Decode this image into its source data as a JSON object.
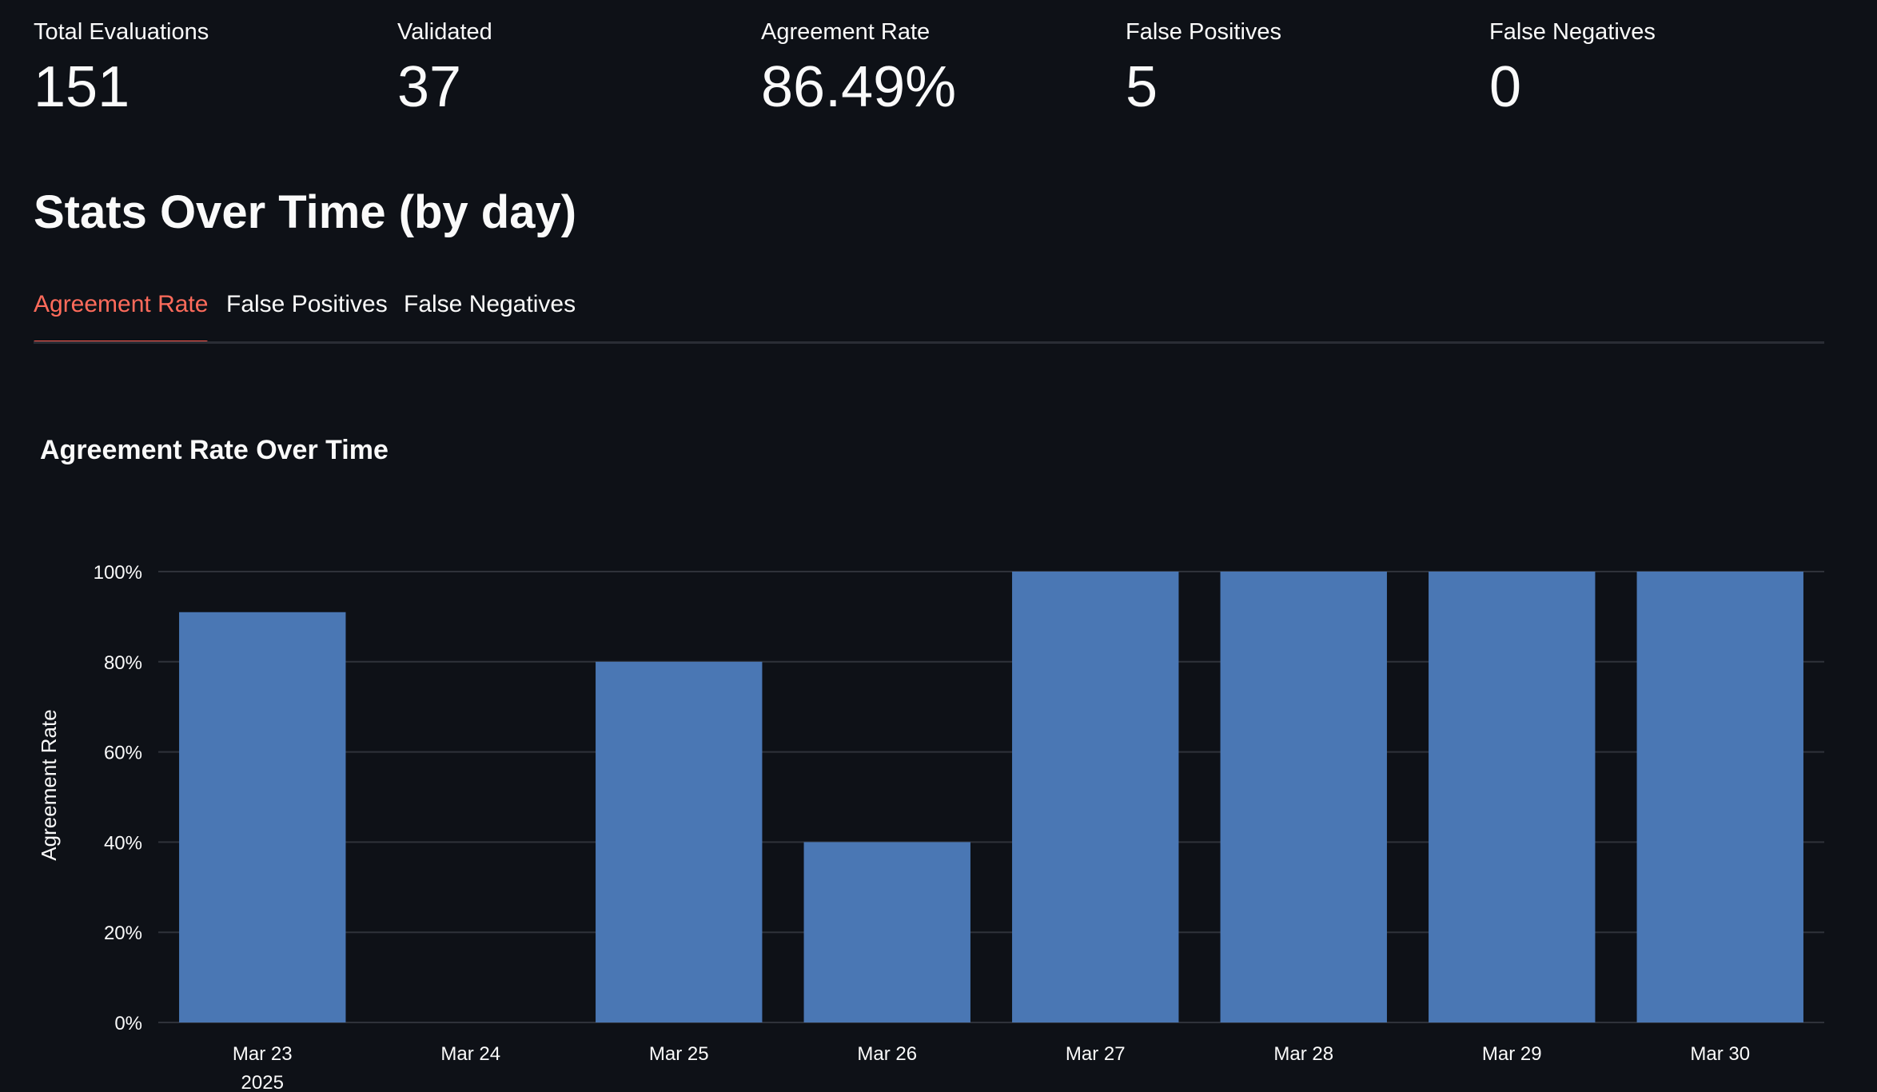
{
  "metrics": [
    {
      "label": "Total Evaluations",
      "value": "151"
    },
    {
      "label": "Validated",
      "value": "37"
    },
    {
      "label": "Agreement Rate",
      "value": "86.49%"
    },
    {
      "label": "False Positives",
      "value": "5"
    },
    {
      "label": "False Negatives",
      "value": "0"
    }
  ],
  "section": {
    "title": "Stats Over Time (by day)"
  },
  "tabs": [
    {
      "label": "Agreement Rate",
      "active": true
    },
    {
      "label": "False Positives",
      "active": false
    },
    {
      "label": "False Negatives",
      "active": false
    }
  ],
  "colors": {
    "background": "#0e1117",
    "accent": "#ff5a4f",
    "bar": "#4a77b4",
    "grid": "#2f323a",
    "text": "#fafafa"
  },
  "chart_data": {
    "type": "bar",
    "title": "Agreement Rate Over Time",
    "ylabel": "Agreement Rate",
    "xlabel": "",
    "year_label": "2025",
    "categories": [
      "Mar 23",
      "Mar 24",
      "Mar 25",
      "Mar 26",
      "Mar 27",
      "Mar 28",
      "Mar 29",
      "Mar 30"
    ],
    "values": [
      91,
      null,
      80,
      40,
      100,
      100,
      100,
      100
    ],
    "ylim": [
      0,
      100
    ],
    "yticks": [
      0,
      20,
      40,
      60,
      80,
      100
    ],
    "ytick_labels": [
      "0%",
      "20%",
      "40%",
      "60%",
      "80%",
      "100%"
    ],
    "grid": true,
    "legend": "none"
  }
}
